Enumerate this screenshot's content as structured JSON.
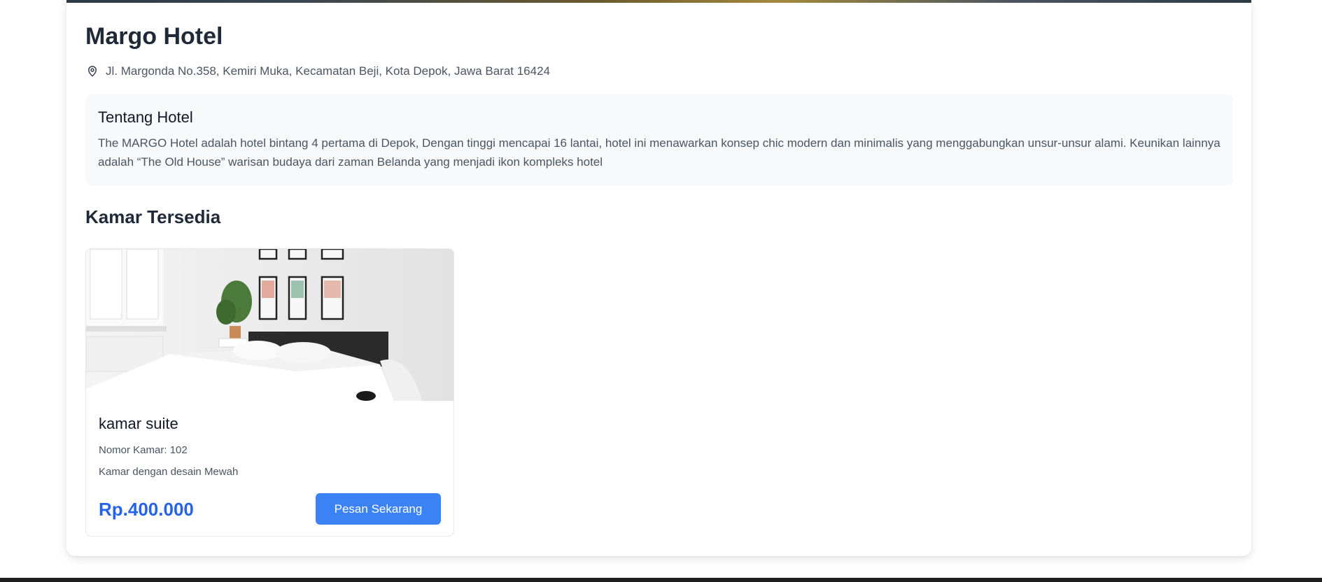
{
  "hotel": {
    "name": "Margo Hotel",
    "address": "Jl. Margonda No.358, Kemiri Muka, Kecamatan Beji, Kota Depok, Jawa Barat 16424",
    "address_icon": "map-pin-icon"
  },
  "about": {
    "title": "Tentang Hotel",
    "description": "The MARGO Hotel adalah hotel bintang 4 pertama di Depok, Dengan tinggi mencapai 16 lantai, hotel ini menawarkan konsep chic modern dan minimalis yang menggabungkan unsur-unsur alami. Keunikan lainnya adalah “The Old House” warisan budaya dari zaman Belanda yang menjadi ikon kompleks hotel"
  },
  "rooms": {
    "heading": "Kamar Tersedia",
    "items": [
      {
        "name": "kamar suite",
        "number": "Nomor Kamar: 102",
        "description": "Kamar dengan desain Mewah",
        "price": "Rp.400.000",
        "book_label": "Pesan Sekarang"
      }
    ]
  },
  "colors": {
    "accent": "#3b82f6",
    "price": "#2563eb",
    "about_bg": "#f8f9fb"
  }
}
